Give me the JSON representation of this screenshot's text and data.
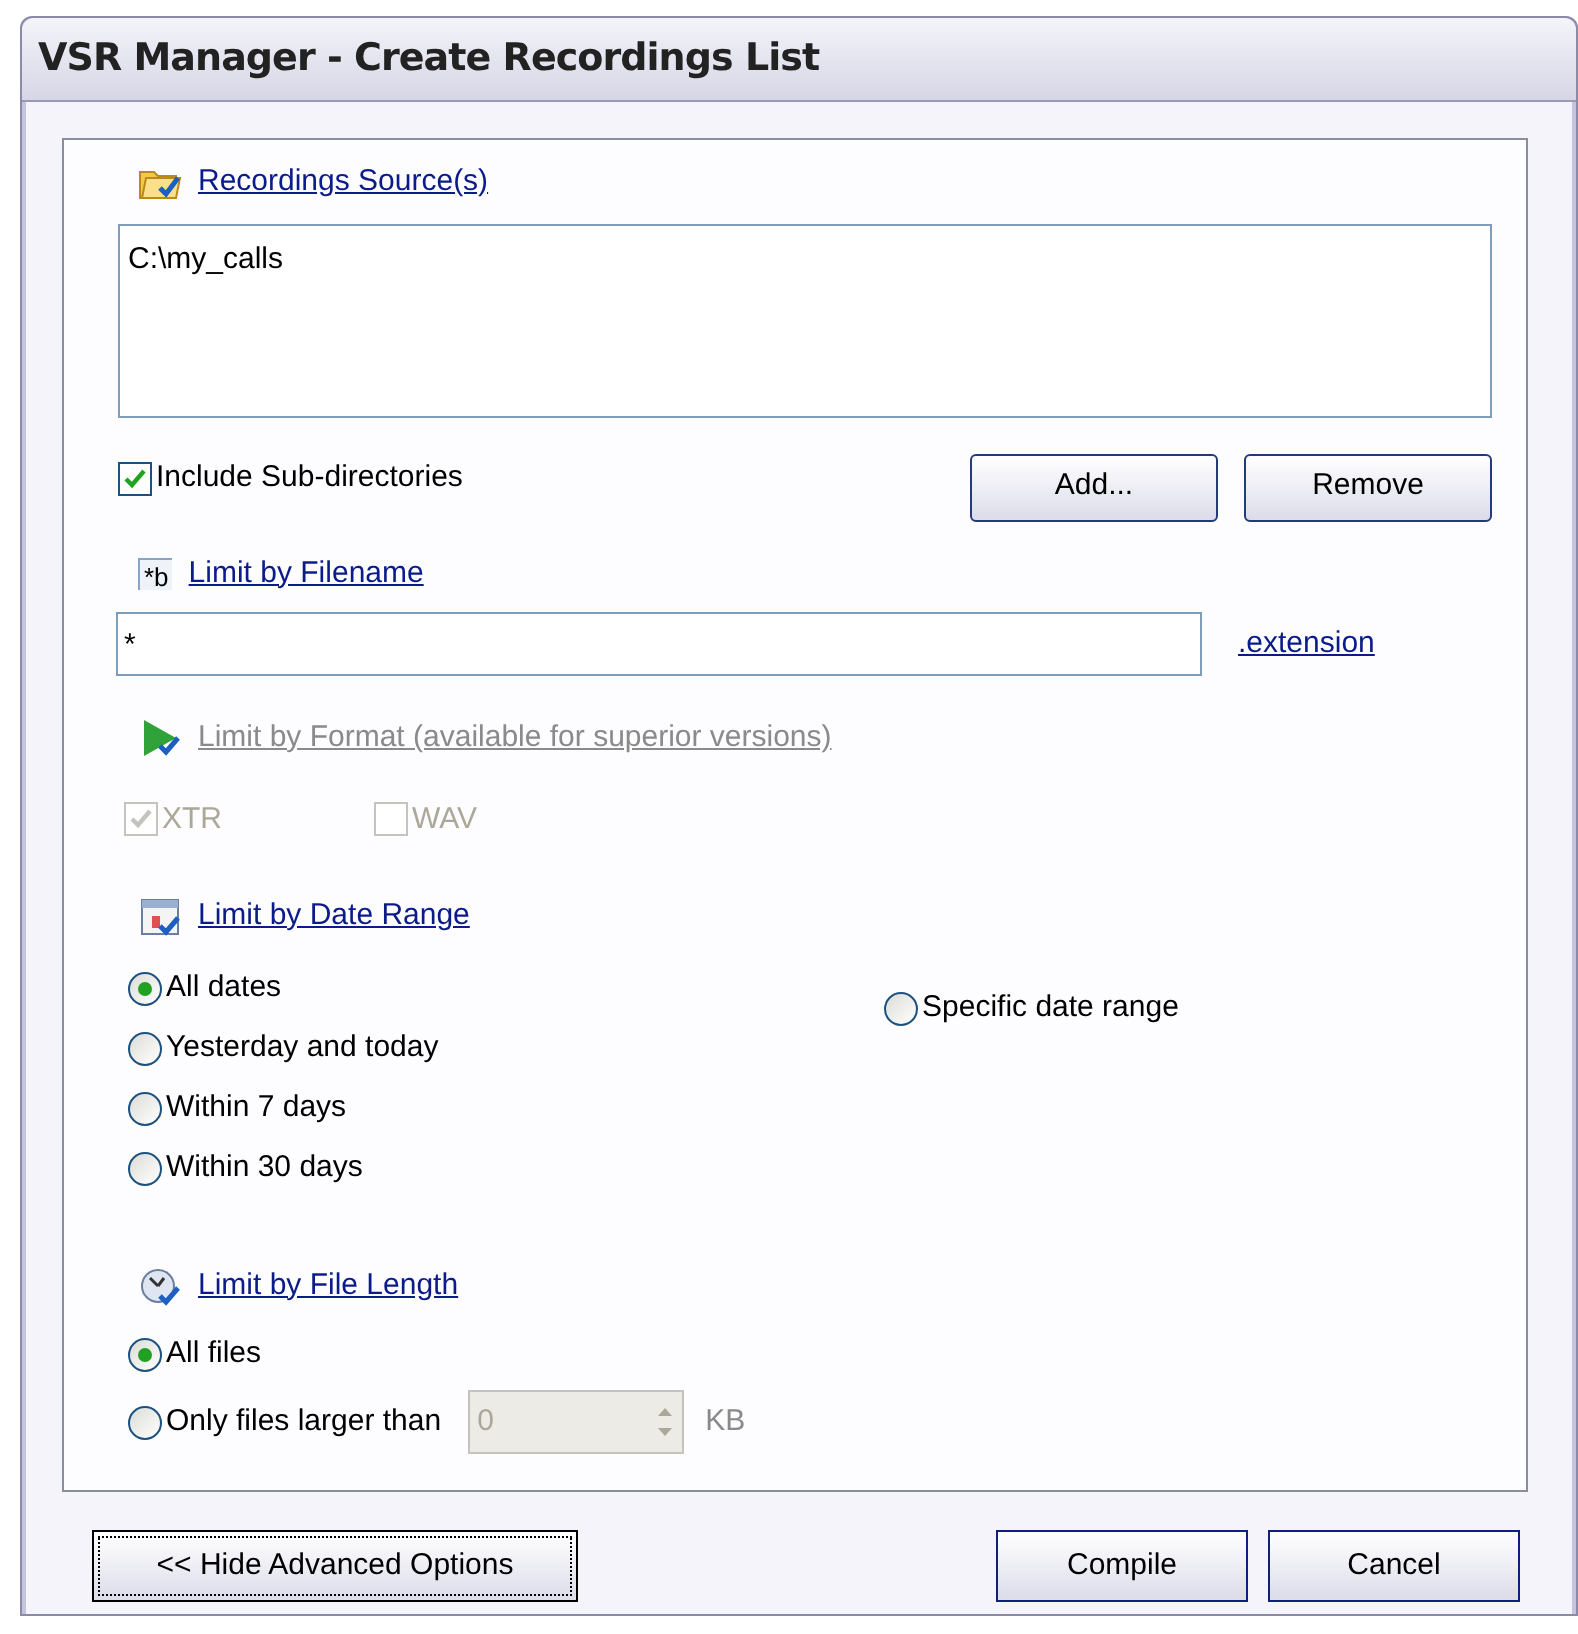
{
  "window": {
    "title": "VSR Manager - Create Recordings List"
  },
  "sources": {
    "heading": "Recordings Source(s)",
    "items": [
      "C:\\my_calls"
    ],
    "include_subdirs": {
      "label": "Include Sub-directories",
      "checked": true
    },
    "buttons": [
      "Add...",
      "Remove"
    ]
  },
  "filename": {
    "heading": "Limit by Filename",
    "icon_text": "*b",
    "value": "*",
    "link": ".extension"
  },
  "format": {
    "heading": "Limit by Format (available for superior versions)",
    "disabled": true,
    "options": [
      {
        "label": "XTR",
        "checked": true
      },
      {
        "label": "WAV",
        "checked": false
      }
    ]
  },
  "date_range": {
    "heading": "Limit by Date Range",
    "options": [
      {
        "label": "All dates",
        "selected": true
      },
      {
        "label": "Yesterday and today",
        "selected": false
      },
      {
        "label": "Within 7 days",
        "selected": false
      },
      {
        "label": "Within 30 days",
        "selected": false
      }
    ],
    "specific": {
      "label": "Specific date range",
      "selected": false
    }
  },
  "file_length": {
    "heading": "Limit by File Length",
    "options": [
      {
        "label": "All files",
        "selected": true
      },
      {
        "label": "Only files larger than",
        "selected": false
      }
    ],
    "size_value": "0",
    "size_unit": "KB",
    "size_disabled": true
  },
  "footer": {
    "toggle": "<< Hide Advanced Options",
    "buttons": [
      "Compile",
      "Cancel"
    ]
  }
}
